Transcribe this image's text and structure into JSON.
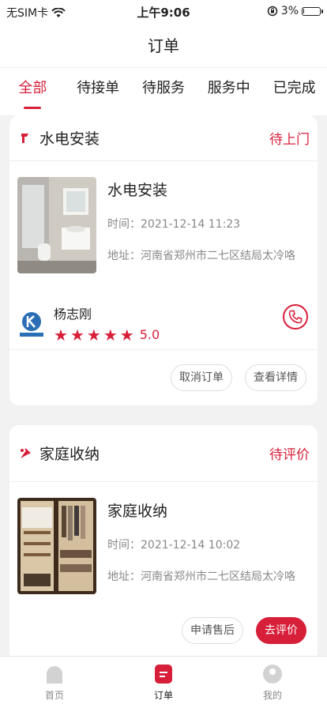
{
  "status_bar": {
    "carrier": "无SIM卡",
    "time": "上午9:06",
    "battery_pct_label": "3%",
    "battery_level": 0.03
  },
  "nav": {
    "title": "订单"
  },
  "tabs": [
    {
      "label": "全部",
      "active": true
    },
    {
      "label": "待接单",
      "active": false
    },
    {
      "label": "待服务",
      "active": false
    },
    {
      "label": "服务中",
      "active": false
    },
    {
      "label": "已完成",
      "active": false
    }
  ],
  "orders": [
    {
      "category": "水电安装",
      "status": "待上门",
      "service": "水电安装",
      "time": "时间：2021-12-14 11:23",
      "address": "地址：河南省郑州市二七区结局太冷咯",
      "worker": {
        "name": "杨志刚",
        "score": "5.0",
        "stars": 5
      },
      "buttons": [
        "取消订单",
        "查看详情"
      ]
    },
    {
      "category": "家庭收纳",
      "status": "待评价",
      "service": "家庭收纳",
      "time": "时间：2021-12-14 10:02",
      "address": "地址：河南省郑州市二七区结局太冷咯",
      "buttons": [
        "申请售后",
        "去评价"
      ]
    }
  ],
  "tabbar": [
    {
      "label": "首页",
      "icon": "home-icon"
    },
    {
      "label": "订单",
      "icon": "order-icon",
      "active": true
    },
    {
      "label": "我的",
      "icon": "profile-icon"
    }
  ],
  "colors": {
    "accent": "#d71f3a"
  }
}
